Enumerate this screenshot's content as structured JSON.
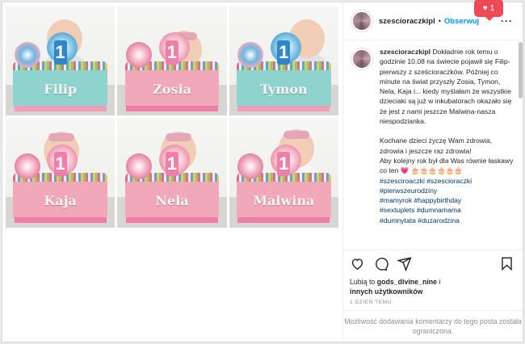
{
  "notification": {
    "icon": "heart-icon",
    "count": "1"
  },
  "profile": {
    "username": "szescioraczkipl",
    "separator": "•",
    "follow_label": "Obserwuj",
    "more_label": "···"
  },
  "photos": [
    {
      "name": "Filip",
      "theme": "blue",
      "candle": "1"
    },
    {
      "name": "Zosia",
      "theme": "pink",
      "candle": "1"
    },
    {
      "name": "Tymon",
      "theme": "blue",
      "candle": "1"
    },
    {
      "name": "Kaja",
      "theme": "pink",
      "candle": "1"
    },
    {
      "name": "Nela",
      "theme": "pink",
      "candle": "1"
    },
    {
      "name": "Malwina",
      "theme": "pink",
      "candle": "1"
    }
  ],
  "caption": {
    "username": "szescioraczkipl",
    "text1": " Dokładnie rok temu o godzinie 10.08 na świecie pojawił się Filip- pierwszy z sześcioraczków. Później co minute na świat przyszły Zosia, Tymon, Nela, Kaja i... kiedy myślałam że wszystkie dzieciaki są już w inkubatorach okazało się że jest z nami jeszcze Malwina-nasza niespodzianka.",
    "text2": "Kochane dzieci życzę Wam zdrowia, zdrowia i jeszcze raz zdrowia!\nAby kolejny rok był dla Was równie łaskawy co ten 💗 🎂🎂🎂🎂🎂🎂",
    "hashtags": [
      "#szesciroaczki #szescioraczki",
      "#pierwszeurodziny",
      "#mamyrok #happybirthday",
      "#sextuplets #dumnamama",
      "#dumnytata #duzarodzina"
    ]
  },
  "actions": {
    "like_icon": "heart-outline-icon",
    "comment_icon": "comment-icon",
    "share_icon": "share-icon",
    "save_icon": "bookmark-icon"
  },
  "likes": {
    "prefix": "Lubią to ",
    "user": "gods_divine_nine",
    "joiner": " i",
    "others": "innych użytkowników"
  },
  "date": "1 DZIEŃ TEMU",
  "comments_disabled": "Możliwość dodawania komentarzy do tego posta została ograniczona.",
  "colors": {
    "accent": "#0095f6",
    "hashtag": "#00376b",
    "notif": "#ed4956",
    "cake_blue": "#8fd3cf",
    "cake_pink": "#f1a8b8"
  }
}
